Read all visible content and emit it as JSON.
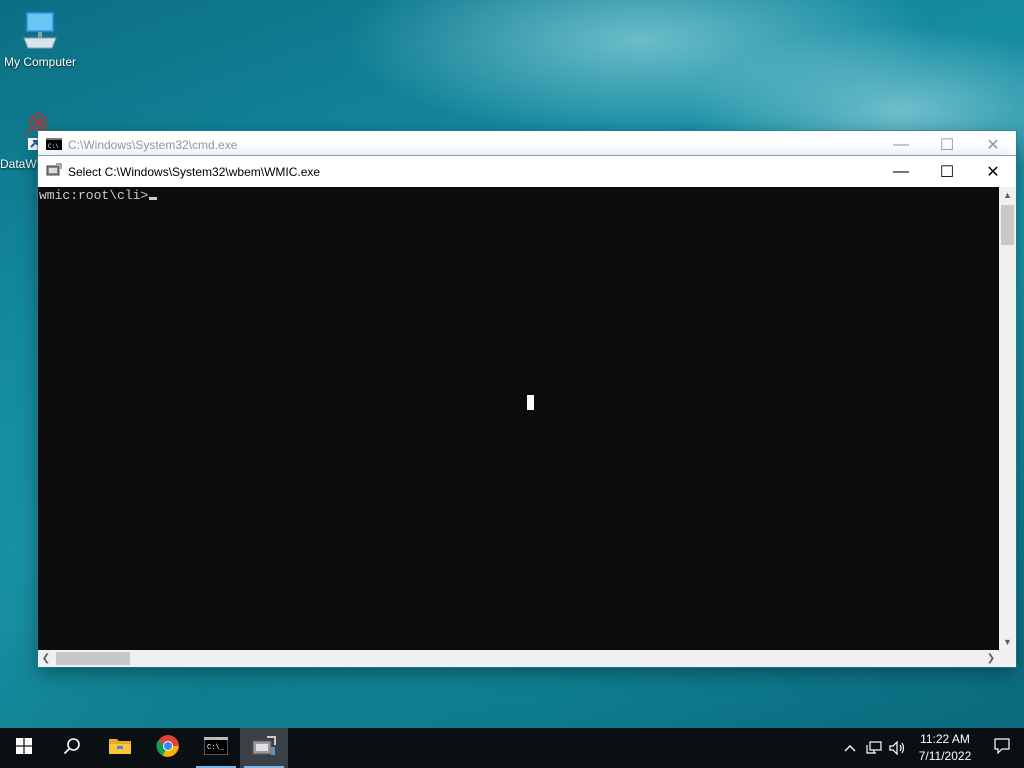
{
  "desktop": {
    "icons": [
      {
        "label": "My Computer"
      },
      {
        "label": "DataW"
      }
    ]
  },
  "windows": {
    "cmd": {
      "title": "C:\\Windows\\System32\\cmd.exe"
    },
    "wmic": {
      "title": "Select C:\\Windows\\System32\\wbem\\WMIC.exe"
    }
  },
  "console": {
    "prompt": "wmic:root\\cli>"
  },
  "controls": {
    "minimize": "—",
    "maximize": "☐",
    "close": "✕"
  },
  "taskbar": {
    "apps": [
      {
        "icon": "windows-start-icon"
      },
      {
        "icon": "search-icon"
      },
      {
        "icon": "file-explorer-icon"
      },
      {
        "icon": "chrome-icon"
      },
      {
        "icon": "cmd-icon"
      },
      {
        "icon": "wmic-icon"
      }
    ],
    "clock": {
      "time": "11:22 AM",
      "date": "7/11/2022"
    }
  },
  "colors": {
    "accent": "#76b9ed",
    "console_bg": "#0c0c0c",
    "console_fg": "#cccccc",
    "taskbar_bg": "#0a0f14"
  }
}
